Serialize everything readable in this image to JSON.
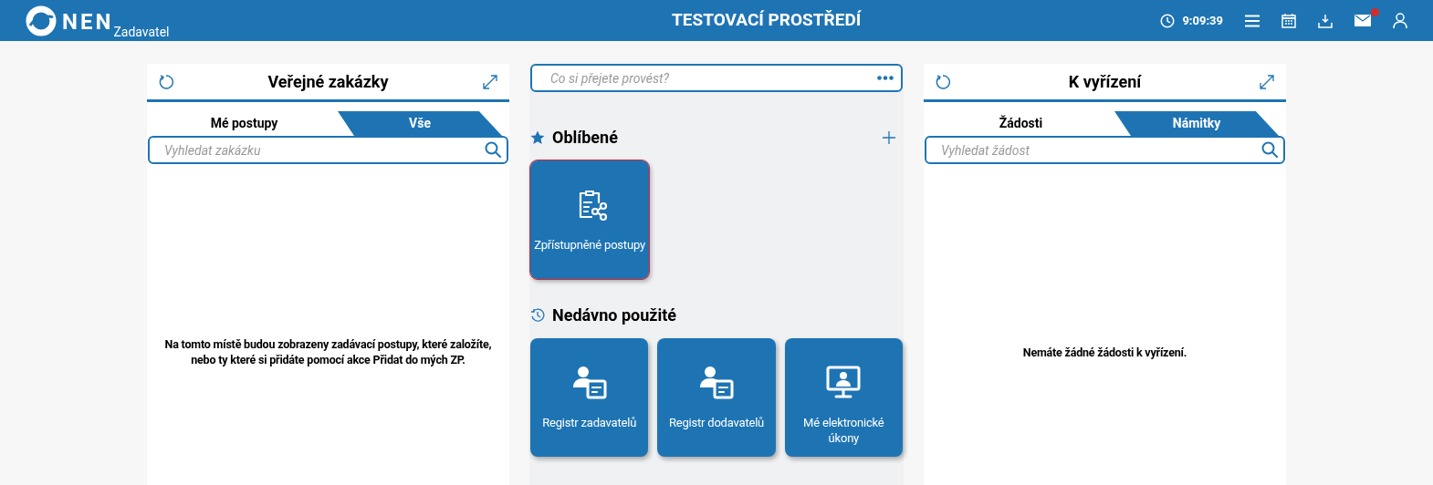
{
  "header": {
    "logo": "NEN",
    "role": "Zadavatel",
    "title": "TESTOVACÍ PROSTŘEDÍ",
    "time": "9:09:39",
    "mail_unread": true
  },
  "left_panel": {
    "title": "Veřejné zakázky",
    "tabs": [
      {
        "label": "Mé postupy",
        "selected": true
      },
      {
        "label": "Vše",
        "selected": false
      }
    ],
    "search": {
      "placeholder": "Vyhledat zakázku"
    },
    "empty_text": "Na tomto místě budou zobrazeny zadávací postupy, které založíte, nebo ty které si přidáte pomocí akce Přidat do mých ZP."
  },
  "command": {
    "placeholder": "Co si přejete provést?"
  },
  "favorites": {
    "title": "Oblíbené",
    "tiles": [
      {
        "label": "Zpřístupněné postupy",
        "kind": "clipboard",
        "selected": true
      }
    ]
  },
  "recent": {
    "title": "Nedávno použité",
    "tiles": [
      {
        "label": "Registr zadavatelů",
        "kind": "person-card",
        "selected": false
      },
      {
        "label": "Registr dodavatelů",
        "kind": "person-card",
        "selected": false
      },
      {
        "label": "Mé elektronické úkony",
        "kind": "monitor",
        "selected": false
      }
    ]
  },
  "right_panel": {
    "title": "K vyřízení",
    "tabs": [
      {
        "label": "Žádosti",
        "selected": true
      },
      {
        "label": "Námitky",
        "selected": false
      }
    ],
    "search": {
      "placeholder": "Vyhledat žádost"
    },
    "empty_text": "Nemáte žádné žádosti k vyřízení."
  }
}
